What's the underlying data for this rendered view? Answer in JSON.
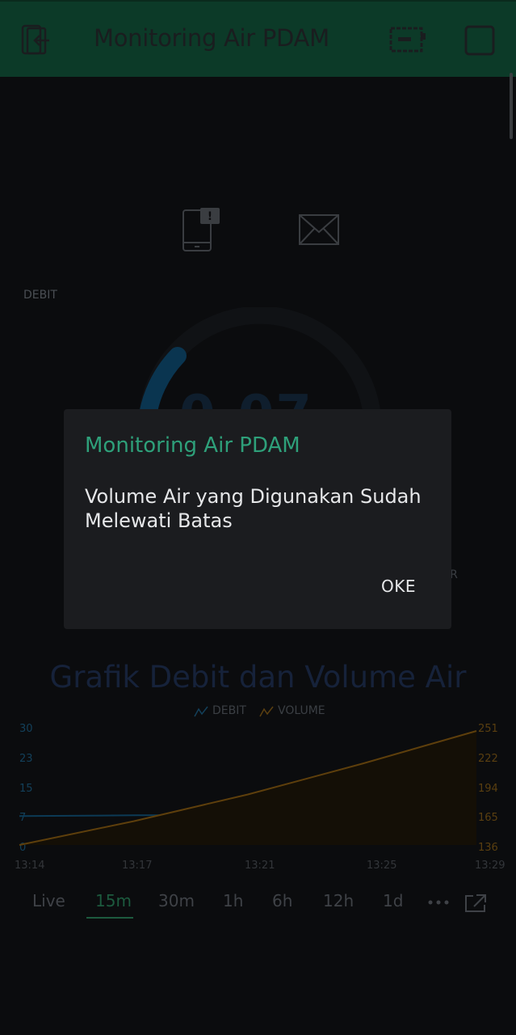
{
  "app": {
    "title": "Monitoring Air PDAM"
  },
  "widgets": {
    "debit_label": "DEBIT",
    "gauge_value": "0.07",
    "partial_label": "IR"
  },
  "chart": {
    "title": "Grafik Debit dan Volume Air",
    "legend": [
      "DEBIT",
      "VOLUME"
    ],
    "left_ticks": [
      "30",
      "23",
      "15",
      "7",
      "0"
    ],
    "right_ticks": [
      "251",
      "222",
      "194",
      "165",
      "136"
    ],
    "x_ticks": [
      "13:14",
      "13:17",
      "13:21",
      "13:25",
      "13:29"
    ]
  },
  "chart_data": {
    "type": "line",
    "title": "Grafik Debit dan Volume Air",
    "x": [
      "13:14",
      "13:17",
      "13:21",
      "13:25",
      "13:29"
    ],
    "series": [
      {
        "name": "DEBIT",
        "axis": "left",
        "color": "#0e6a95",
        "values": [
          7.6,
          7.8,
          7.9,
          8.1,
          8.9
        ]
      },
      {
        "name": "VOLUME",
        "axis": "right",
        "color": "#b5790f",
        "values": [
          136,
          160,
          187,
          218,
          251
        ]
      }
    ],
    "ylim_left": [
      0,
      30
    ],
    "ylim_right": [
      136,
      251
    ]
  },
  "timeranges": [
    "Live",
    "15m",
    "30m",
    "1h",
    "6h",
    "12h",
    "1d"
  ],
  "timerange_active": "15m",
  "dialog": {
    "title": "Monitoring Air PDAM",
    "message": "Volume Air yang Digunakan Sudah Melewati Batas",
    "button": "OKE"
  },
  "colors": {
    "topbar": "#0c3a28",
    "dialog_title": "#2ea07a",
    "debit": "#0e6a95",
    "volume": "#b5790f"
  }
}
